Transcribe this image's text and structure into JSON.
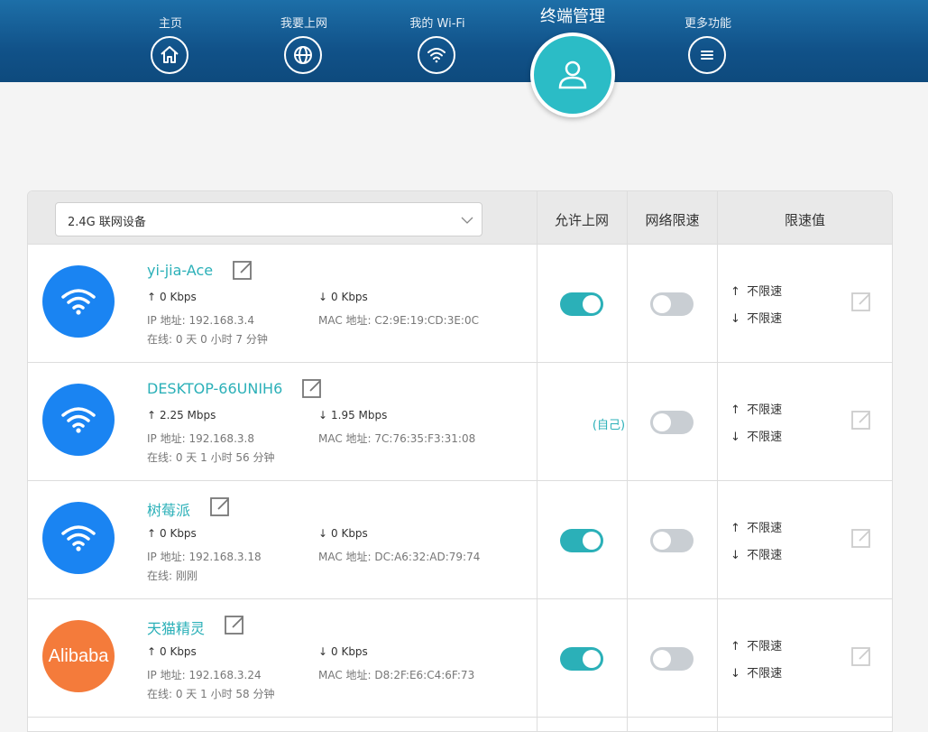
{
  "nav": [
    {
      "label": "主页",
      "icon": "home-icon"
    },
    {
      "label": "我要上网",
      "icon": "globe-icon"
    },
    {
      "label": "我的 Wi-Fi",
      "icon": "wifi-icon"
    },
    {
      "label": "终端管理",
      "icon": "user-icon",
      "active": true
    },
    {
      "label": "更多功能",
      "icon": "menu-icon"
    }
  ],
  "table": {
    "band_select": "2.4G 联网设备",
    "headers": {
      "allow": "允许上网",
      "limit": "网络限速",
      "limit_value": "限速值"
    }
  },
  "devices": [
    {
      "name": "yi-jia-Ace",
      "avatar": "wifi",
      "up": "0 Kbps",
      "down": "0 Kbps",
      "ip": "IP 地址: 192.168.3.4",
      "mac": "MAC 地址: C2:9E:19:CD:3E:0C",
      "online": "在线: 0 天 0 小时 7 分钟",
      "allow": true,
      "limit": false,
      "up_limit": "不限速",
      "down_limit": "不限速"
    },
    {
      "name": "DESKTOP-66UNIH6",
      "avatar": "wifi",
      "up": "2.25 Mbps",
      "down": "1.95 Mbps",
      "ip": "IP 地址: 192.168.3.8",
      "mac": "MAC 地址: 7C:76:35:F3:31:08",
      "online": "在线: 0 天 1 小时 56 分钟",
      "allow_label": "(自己)",
      "limit": false,
      "up_limit": "不限速",
      "down_limit": "不限速"
    },
    {
      "name": "树莓派",
      "avatar": "wifi",
      "up": "0 Kbps",
      "down": "0 Kbps",
      "ip": "IP 地址: 192.168.3.18",
      "mac": "MAC 地址: DC:A6:32:AD:79:74",
      "online": "在线: 刚刚",
      "allow": true,
      "limit": false,
      "up_limit": "不限速",
      "down_limit": "不限速"
    },
    {
      "name": "天猫精灵",
      "avatar": "text",
      "avatar_text": "Alibaba",
      "avatar_color": "#f47b3b",
      "up": "0 Kbps",
      "down": "0 Kbps",
      "ip": "IP 地址: 192.168.3.24",
      "mac": "MAC 地址: D8:2F:E6:C4:6F:73",
      "online": "在线: 0 天 1 小时 58 分钟",
      "allow": true,
      "limit": false,
      "up_limit": "不限速",
      "down_limit": "不限速"
    }
  ],
  "colors": {
    "accent": "#2bb0b8",
    "header": "#115289",
    "avatar_blue": "#1a84f2"
  }
}
